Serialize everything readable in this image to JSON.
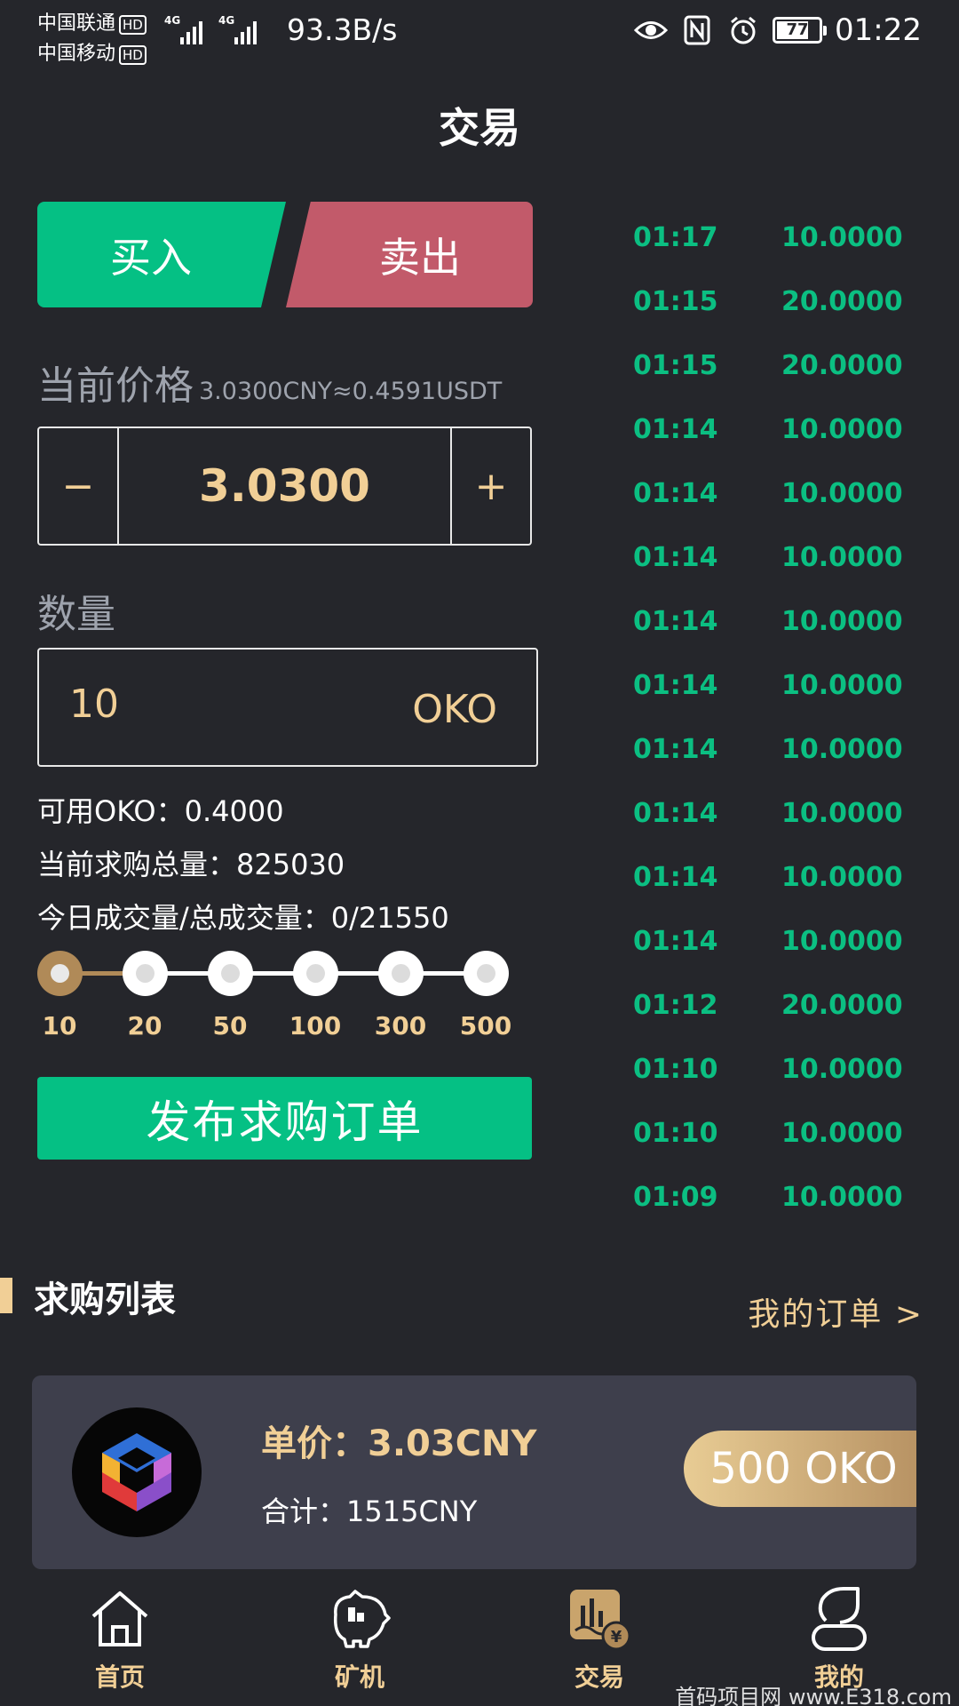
{
  "status_bar": {
    "carrier1": "中国联通",
    "carrier2": "中国移动",
    "hd_badge": "HD",
    "net_type": "4G",
    "net_speed": "93.3B/s",
    "battery": "77",
    "time": "01:22"
  },
  "page": {
    "title": "交易"
  },
  "trade_tabs": {
    "buy_label": "买入",
    "sell_label": "卖出"
  },
  "price": {
    "label": "当前价格",
    "conversion": "3.0300CNY≈0.4591USDT",
    "minus": "−",
    "value": "3.0300",
    "plus": "+"
  },
  "quantity": {
    "label": "数量",
    "value": "10",
    "unit": "OKO"
  },
  "info": {
    "available": "可用OKO：0.4000",
    "total_demand": "当前求购总量：825030",
    "volume": "今日成交量/总成交量：0/21550"
  },
  "slider": {
    "ticks": [
      "10",
      "20",
      "50",
      "100",
      "300",
      "500"
    ],
    "selected": "10"
  },
  "publish_button": "发布求购订单",
  "trades": [
    {
      "time": "01:17",
      "amount": "10.0000"
    },
    {
      "time": "01:15",
      "amount": "20.0000"
    },
    {
      "time": "01:15",
      "amount": "20.0000"
    },
    {
      "time": "01:14",
      "amount": "10.0000"
    },
    {
      "time": "01:14",
      "amount": "10.0000"
    },
    {
      "time": "01:14",
      "amount": "10.0000"
    },
    {
      "time": "01:14",
      "amount": "10.0000"
    },
    {
      "time": "01:14",
      "amount": "10.0000"
    },
    {
      "time": "01:14",
      "amount": "10.0000"
    },
    {
      "time": "01:14",
      "amount": "10.0000"
    },
    {
      "time": "01:14",
      "amount": "10.0000"
    },
    {
      "time": "01:14",
      "amount": "10.0000"
    },
    {
      "time": "01:12",
      "amount": "20.0000"
    },
    {
      "time": "01:10",
      "amount": "10.0000"
    },
    {
      "time": "01:10",
      "amount": "10.0000"
    },
    {
      "time": "01:09",
      "amount": "10.0000"
    }
  ],
  "orders_section": {
    "title": "求购列表",
    "my_orders": "我的订单 >"
  },
  "order": {
    "unit_price": "单价：3.03CNY",
    "total": "合计：1515CNY",
    "amount": "500 OKO"
  },
  "nav": [
    {
      "label": "首页",
      "icon": "home-icon"
    },
    {
      "label": "矿机",
      "icon": "miner-icon"
    },
    {
      "label": "交易",
      "icon": "trade-icon"
    },
    {
      "label": "我的",
      "icon": "profile-icon"
    }
  ],
  "watermark": "首码项目网 www.E318.com",
  "colors": {
    "background": "#25262b",
    "buy": "#05c084",
    "sell": "#c25a6a",
    "gold": "#f1cf96",
    "card": "#3e3f4c"
  }
}
